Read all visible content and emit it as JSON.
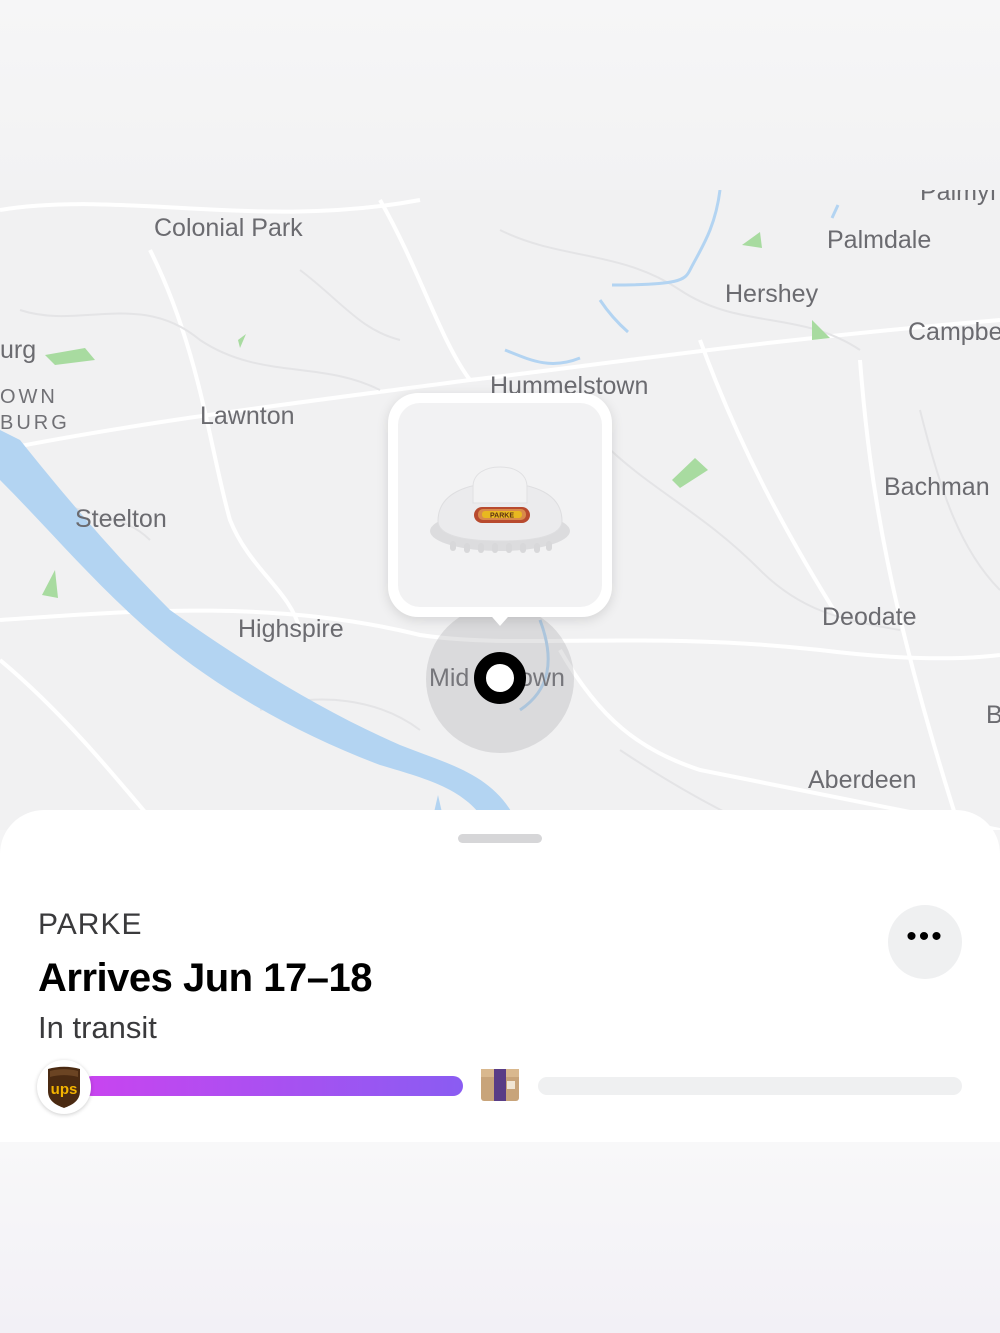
{
  "map": {
    "labels": [
      {
        "id": "colonial-park",
        "text": "Colonial Park"
      },
      {
        "id": "palmyra",
        "text": "Palmyı"
      },
      {
        "id": "palmdale",
        "text": "Palmdale"
      },
      {
        "id": "hershey",
        "text": "Hershey"
      },
      {
        "id": "campbelltown",
        "text": "Campbe"
      },
      {
        "id": "harrisburg-partial",
        "text": "urg"
      },
      {
        "id": "town-caps",
        "text": "OWN"
      },
      {
        "id": "burg-caps",
        "text": "BURG"
      },
      {
        "id": "lawnton",
        "text": "Lawnton"
      },
      {
        "id": "hummelstown",
        "text": "Hummelstown"
      },
      {
        "id": "bachmanville",
        "text": "Bachman"
      },
      {
        "id": "steelton",
        "text": "Steelton"
      },
      {
        "id": "deodate",
        "text": "Deodate"
      },
      {
        "id": "highspire",
        "text": "Highspire"
      },
      {
        "id": "middletown-left",
        "text": "Mid"
      },
      {
        "id": "middletown-right",
        "text": "own"
      },
      {
        "id": "b-edge",
        "text": "B"
      },
      {
        "id": "aberdeen",
        "text": "Aberdeen"
      }
    ],
    "product_text": "PARKE",
    "colors": {
      "water": "#b3d4f2",
      "park": "#a8dba0",
      "road": "#ffffff"
    }
  },
  "shipment": {
    "merchant": "PARKE",
    "arrival": "Arrives Jun 17–18",
    "status": "In transit",
    "more_label": "•••",
    "carrier": "ups",
    "progress": 0.5,
    "progress_colors": [
      "#c944f0",
      "#8a5cf2"
    ]
  },
  "icons": {
    "more": "more-horizontal-icon",
    "carrier": "ups-logo-icon",
    "package": "package-icon"
  }
}
